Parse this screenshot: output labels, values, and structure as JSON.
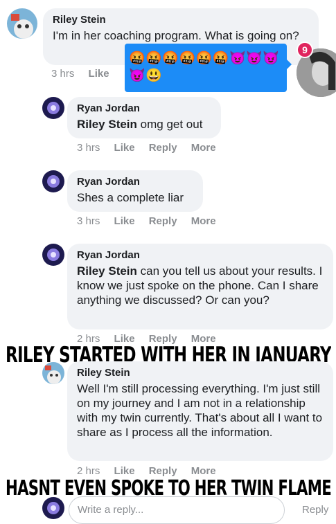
{
  "comments": [
    {
      "author": "Riley Stein",
      "text": "I'm in her coaching program. What is going on?",
      "time": "3 hrs",
      "actions": [
        "Like"
      ]
    },
    {
      "author": "Ryan Jordan",
      "mention": "Riley Stein",
      "text": " omg get out",
      "time": "3 hrs",
      "actions": [
        "Like",
        "Reply",
        "More"
      ]
    },
    {
      "author": "Ryan Jordan",
      "text": "Shes a complete liar",
      "time": "3 hrs",
      "actions": [
        "Like",
        "Reply",
        "More"
      ]
    },
    {
      "author": "Ryan Jordan",
      "mention": "Riley Stein",
      "text": " can you tell us about your results. I know we just spoke on the phone. Can I share anything we discussed? Or can you?",
      "time": "2 hrs",
      "actions": [
        "Like",
        "Reply",
        "More"
      ]
    },
    {
      "author": "Riley Stein",
      "text": "Well I'm still processing everything. I'm just still on my journey and I am not in a relationship with my twin currently. That's about all I want to share as I process all the information.",
      "time": "2 hrs",
      "actions": [
        "Like",
        "Reply",
        "More"
      ]
    }
  ],
  "tooltip": {
    "emojis_row1": "🤬🤬🤬🤬🤬🤬😈😈😈",
    "emojis_row2": "😈😃"
  },
  "chat_head": {
    "badge": "9"
  },
  "overlays": {
    "caption1": "RILEY STARTED WITH HER IN JANUARY",
    "caption2": "HASNT EVEN SPOKE TO HER TWIN FLAME"
  },
  "reply": {
    "placeholder": "Write a reply...",
    "button": "Reply"
  },
  "colors": {
    "bubble": "#f0f2f5",
    "meta": "#8a8d91",
    "tooltip": "#1c8cf7",
    "badge": "#e0245e"
  }
}
